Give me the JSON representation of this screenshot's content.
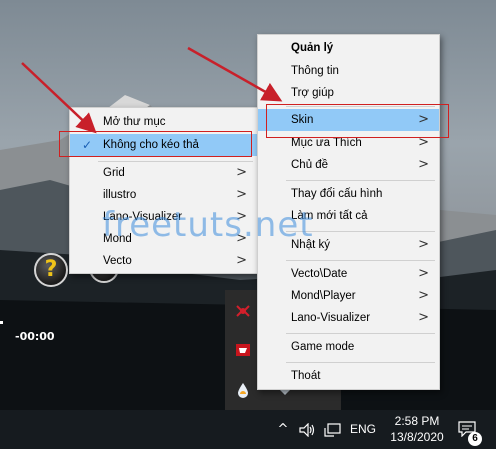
{
  "left_menu": {
    "items": [
      {
        "label": "Mở thư mục",
        "submenu": false,
        "checked": false
      },
      {
        "label": "Không cho kéo thả",
        "submenu": false,
        "checked": true
      },
      {
        "label": "Grid",
        "submenu": true
      },
      {
        "label": "illustro",
        "submenu": true
      },
      {
        "label": "Lano-Visualizer",
        "submenu": true
      },
      {
        "label": "Mond",
        "submenu": true
      },
      {
        "label": "Vecto",
        "submenu": true
      }
    ]
  },
  "right_menu": {
    "items": [
      {
        "label": "Quản lý",
        "submenu": false
      },
      {
        "label": "Thông tin",
        "submenu": false
      },
      {
        "label": "Trợ giúp",
        "submenu": false
      },
      {
        "label": "Skin",
        "submenu": true
      },
      {
        "label": "Mục ưa Thích",
        "submenu": true
      },
      {
        "label": "Chủ đề",
        "submenu": true
      },
      {
        "label": "Thay đổi cấu hình",
        "submenu": false
      },
      {
        "label": "Làm mới tất cả",
        "submenu": false
      },
      {
        "label": "Nhật ký",
        "submenu": true
      },
      {
        "label": "Vecto\\Date",
        "submenu": true
      },
      {
        "label": "Mond\\Player",
        "submenu": true
      },
      {
        "label": "Lano-Visualizer",
        "submenu": true
      },
      {
        "label": "Game mode",
        "submenu": false
      },
      {
        "label": "Thoát",
        "submenu": false
      }
    ]
  },
  "arrow_glyph": ">",
  "check_glyph": "✓",
  "widgets": {
    "clock_text": "-00:00",
    "question_glyph": "?"
  },
  "watermark": "freetuts.net",
  "taskbar": {
    "chevron": "^",
    "language": "ENG",
    "time": "2:58 PM",
    "date": "13/8/2020",
    "notification_count": "6"
  },
  "colors": {
    "highlight": "#91c9f7",
    "annotation": "#d02020",
    "taskbar": "#161b1f"
  }
}
